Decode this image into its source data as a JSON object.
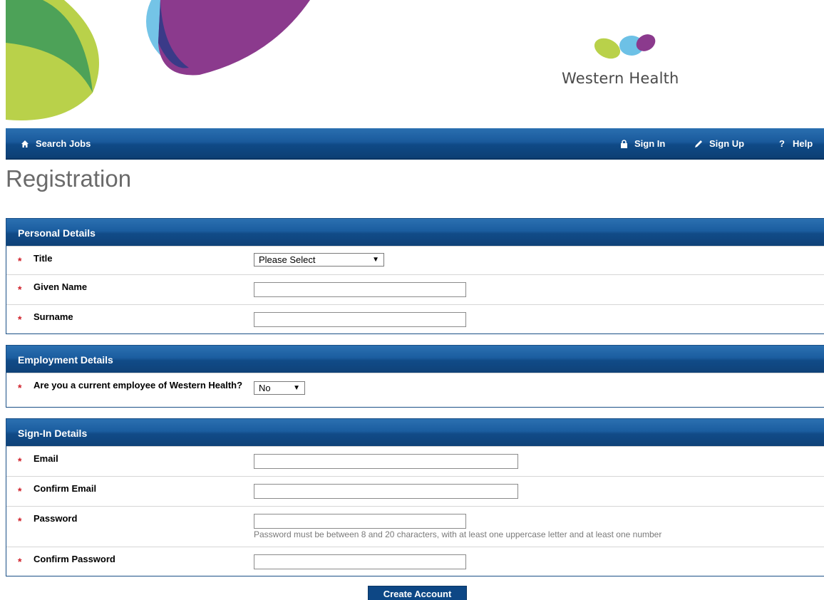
{
  "brand": {
    "name": "Western Health"
  },
  "nav": {
    "search_jobs": "Search Jobs",
    "sign_in": "Sign In",
    "sign_up": "Sign Up",
    "help": "Help",
    "icons": {
      "search_jobs": "home-icon",
      "sign_in": "lock-icon",
      "sign_up": "pencil-icon",
      "help": "question-icon"
    }
  },
  "page": {
    "title": "Registration"
  },
  "personal": {
    "heading": "Personal Details",
    "title_label": "Title",
    "title_value": "Please Select",
    "given_name_label": "Given Name",
    "given_name_value": "",
    "surname_label": "Surname",
    "surname_value": ""
  },
  "employment": {
    "heading": "Employment Details",
    "current_employee_label": "Are you a current employee of Western Health?",
    "current_employee_value": "No"
  },
  "signin": {
    "heading": "Sign-In Details",
    "email_label": "Email",
    "email_value": "",
    "confirm_email_label": "Confirm Email",
    "confirm_email_value": "",
    "password_label": "Password",
    "password_value": "",
    "password_hint": "Password must be between 8 and 20 characters, with at least one uppercase letter and at least one number",
    "confirm_password_label": "Confirm Password",
    "confirm_password_value": ""
  },
  "actions": {
    "create_account": "Create Account"
  },
  "required_marker": "*",
  "colors": {
    "nav_blue": "#1a5a9c",
    "button_blue": "#0d4785",
    "required_red": "#d0202a",
    "title_grey": "#6a6a6a"
  }
}
